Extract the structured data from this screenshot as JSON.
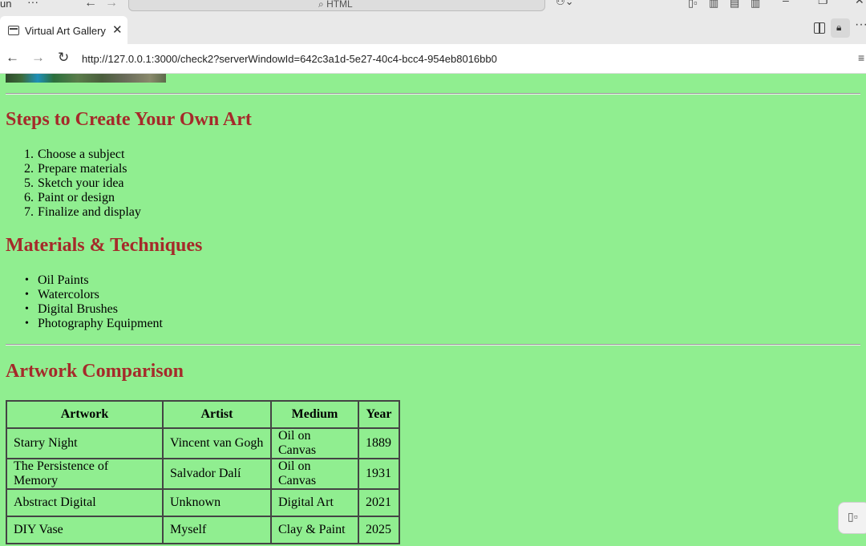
{
  "titlebar": {
    "left_text": "un",
    "dots": "···",
    "search_text": "HTML"
  },
  "tab": {
    "title": "Virtual Art Gallery",
    "close": "✕"
  },
  "tabstrip": {
    "more": "···"
  },
  "addressbar": {
    "back": "←",
    "forward": "→",
    "reload": "↻",
    "url": "http://127.0.0.1:3000/check2?serverWindowId=642c3a1d-5e27-40c4-bcc4-954eb8016bb0",
    "menu": "≡"
  },
  "page": {
    "steps": {
      "heading": "Steps to Create Your Own Art",
      "items": [
        {
          "num": "1.",
          "text": "Choose a subject"
        },
        {
          "num": "2.",
          "text": "Prepare materials"
        },
        {
          "num": "5.",
          "text": "Sketch your idea"
        },
        {
          "num": "6.",
          "text": "Paint or design"
        },
        {
          "num": "7.",
          "text": "Finalize and display"
        }
      ]
    },
    "materials": {
      "heading": "Materials & Techniques",
      "items": [
        "Oil Paints",
        "Watercolors",
        "Digital Brushes",
        "Photography Equipment"
      ]
    },
    "comparison": {
      "heading": "Artwork Comparison",
      "columns": [
        "Artwork",
        "Artist",
        "Medium",
        "Year"
      ],
      "rows": [
        [
          "Starry Night",
          "Vincent van Gogh",
          "Oil on Canvas",
          "1889"
        ],
        [
          "The Persistence of Memory",
          "Salvador Dalí",
          "Oil on Canvas",
          "1931"
        ],
        [
          "Abstract Digital",
          "Unknown",
          "Digital Art",
          "2021"
        ],
        [
          "DIY Vase",
          "Myself",
          "Clay & Paint",
          "2025"
        ]
      ]
    }
  },
  "colors": {
    "page_background": "#90ee90",
    "heading": "#a52a2a",
    "table_border": "#444444"
  }
}
